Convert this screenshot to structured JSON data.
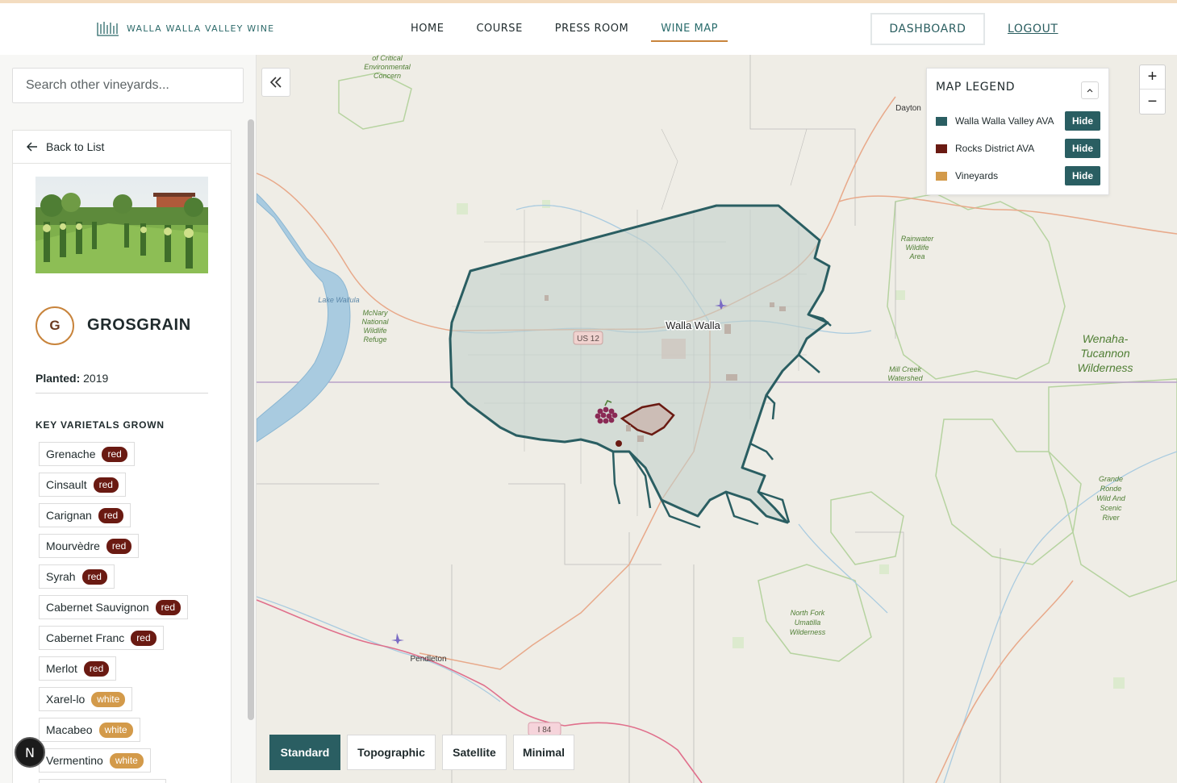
{
  "brand": {
    "name": "WALLA WALLA VALLEY WINE"
  },
  "nav": {
    "items": [
      {
        "label": "HOME"
      },
      {
        "label": "COURSE"
      },
      {
        "label": "PRESS ROOM"
      },
      {
        "label": "WINE MAP"
      }
    ],
    "active": "WINE MAP",
    "dashboard_label": "DASHBOARD",
    "logout_label": "LOGOUT"
  },
  "sidebar": {
    "search_placeholder": "Search other vineyards...",
    "back_label": "Back to List",
    "vineyard": {
      "initial": "G",
      "name": "GROSGRAIN",
      "planted_label": "Planted:",
      "planted_year": "2019",
      "varietals_title": "KEY VARIETALS GROWN",
      "varietals": [
        {
          "name": "Grenache",
          "type": "red"
        },
        {
          "name": "Cinsault",
          "type": "red"
        },
        {
          "name": "Carignan",
          "type": "red"
        },
        {
          "name": "Mourvèdre",
          "type": "red"
        },
        {
          "name": "Syrah",
          "type": "red"
        },
        {
          "name": "Cabernet Sauvignon",
          "type": "red"
        },
        {
          "name": "Cabernet Franc",
          "type": "red"
        },
        {
          "name": "Merlot",
          "type": "red"
        },
        {
          "name": "Xarel-lo",
          "type": "white"
        },
        {
          "name": "Macabeo",
          "type": "white"
        },
        {
          "name": "Vermentino",
          "type": "white"
        }
      ]
    }
  },
  "map": {
    "legend": {
      "title": "MAP LEGEND",
      "items": [
        {
          "label": "Walla Walla Valley AVA",
          "color": "#2a5e62",
          "action": "Hide"
        },
        {
          "label": "Rocks District AVA",
          "color": "#6a1a12",
          "action": "Hide"
        },
        {
          "label": "Vineyards",
          "color": "#d39a4a",
          "action": "Hide"
        }
      ]
    },
    "labels": {
      "walla_walla": "Walla Walla",
      "us12": "US 12",
      "dayton": "Dayton",
      "pendleton": "Pendleton",
      "i84": "I 84",
      "lake_wallula": "Lake Wallula",
      "mcnary_1": "McNary",
      "mcnary_2": "National",
      "mcnary_3": "Wildlife",
      "mcnary_4": "Refuge",
      "critical_1": "of Critical",
      "critical_2": "Environmental",
      "critical_3": "Concern",
      "rainwater_1": "Rainwater",
      "rainwater_2": "Wildlife",
      "rainwater_3": "Area",
      "wenaha_1": "Wenaha-",
      "wenaha_2": "Tucannon",
      "wenaha_3": "Wilderness",
      "millcreek_1": "Mill Creek",
      "millcreek_2": "Watershed",
      "grande_1": "Grande",
      "grande_2": "Ronde",
      "grande_3": "Wild And",
      "grande_4": "Scenic",
      "grande_5": "River",
      "northfork_1": "North Fork",
      "northfork_2": "Umatilla",
      "northfork_3": "Wilderness"
    },
    "styles": [
      {
        "label": "Standard",
        "active": true
      },
      {
        "label": "Topographic",
        "active": false
      },
      {
        "label": "Satellite",
        "active": false
      },
      {
        "label": "Minimal",
        "active": false
      }
    ]
  },
  "dev_badge": "N"
}
